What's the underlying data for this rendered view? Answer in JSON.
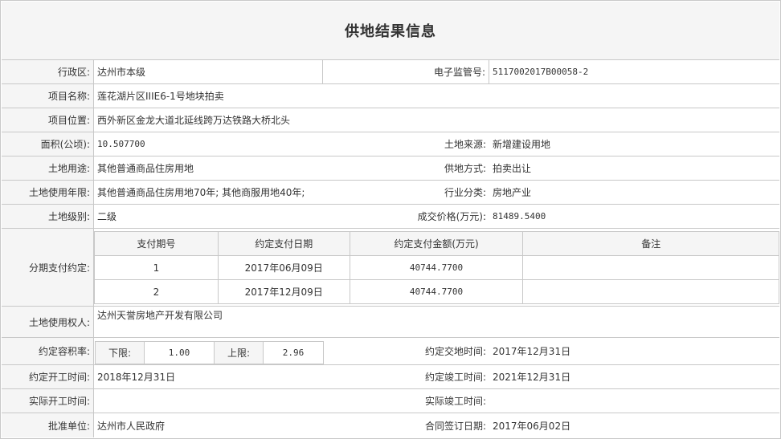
{
  "title": "供地结果信息",
  "rows": {
    "district": {
      "label": "行政区:",
      "value": "达州市本级"
    },
    "supervision_no": {
      "label": "电子监管号:",
      "value": "5117002017B00058-2"
    },
    "project_name": {
      "label": "项目名称:",
      "value": "莲花湖片区IIIE6-1号地块拍卖"
    },
    "project_location": {
      "label": "项目位置:",
      "value": "西外新区金龙大道北延线跨万达铁路大桥北头"
    },
    "area": {
      "label": "面积(公顷):",
      "value": "10.507700"
    },
    "land_source": {
      "label": "土地来源:",
      "value": "新增建设用地"
    },
    "land_use": {
      "label": "土地用途:",
      "value": "其他普通商品住房用地"
    },
    "supply_method": {
      "label": "供地方式:",
      "value": "拍卖出让"
    },
    "use_term": {
      "label": "土地使用年限:",
      "value": "其他普通商品住房用地70年; 其他商服用地40年;"
    },
    "industry": {
      "label": "行业分类:",
      "value": "房地产业"
    },
    "land_grade": {
      "label": "土地级别:",
      "value": "二级"
    },
    "price": {
      "label": "成交价格(万元):",
      "value": "81489.5400"
    },
    "installments": {
      "label": "分期支付约定:",
      "headers": [
        "支付期号",
        "约定支付日期",
        "约定支付金额(万元)",
        "备注"
      ],
      "rows": [
        {
          "no": "1",
          "date": "2017年06月09日",
          "amount": "40744.7700",
          "note": ""
        },
        {
          "no": "2",
          "date": "2017年12月09日",
          "amount": "40744.7700",
          "note": ""
        }
      ]
    },
    "land_user": {
      "label": "土地使用权人:",
      "value": "达州天誉房地产开发有限公司"
    },
    "far": {
      "label": "约定容积率:",
      "lower_label": "下限:",
      "lower": "1.00",
      "upper_label": "上限:",
      "upper": "2.96"
    },
    "delivery_time": {
      "label": "约定交地时间:",
      "value": "2017年12月31日"
    },
    "start_time": {
      "label": "约定开工时间:",
      "value": "2018年12月31日"
    },
    "completion_time": {
      "label": "约定竣工时间:",
      "value": "2021年12月31日"
    },
    "actual_start": {
      "label": "实际开工时间:",
      "value": ""
    },
    "actual_completion": {
      "label": "实际竣工时间:",
      "value": ""
    },
    "approval_unit": {
      "label": "批准单位:",
      "value": "达州市人民政府"
    },
    "contract_date": {
      "label": "合同签订日期:",
      "value": "2017年06月02日"
    }
  }
}
